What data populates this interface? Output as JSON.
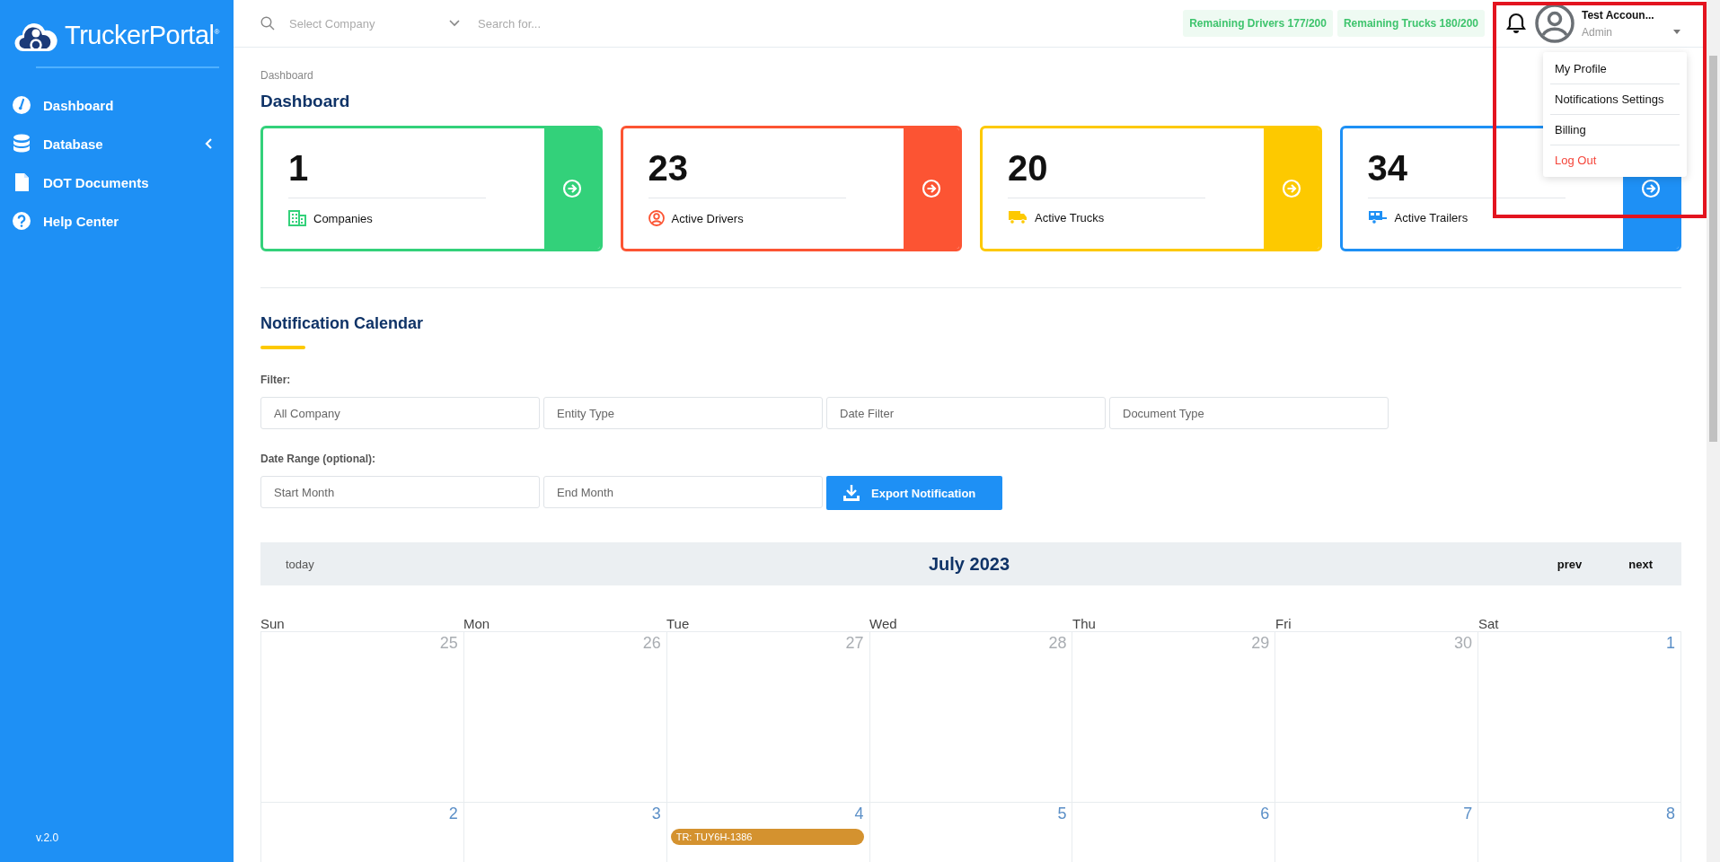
{
  "sidebar": {
    "logo": "TruckerPortal$^{®}$",
    "items": [
      {
        "label": "Dashboard",
        "kind": "gauge",
        "expandable": false
      },
      {
        "label": "Database",
        "kind": "database",
        "expandable": true
      },
      {
        "label": "DOT Documents",
        "kind": "document",
        "expandable": false
      },
      {
        "label": "Help Center",
        "kind": "help",
        "expandable": false
      }
    ],
    "version": "v.2.0"
  },
  "header": {
    "company_select": {
      "placeholder": "Select Company"
    },
    "search": {
      "placeholder": "Search for..."
    },
    "badges": [
      "Remaining Drivers 177/200",
      "Remaining Trucks 180/200"
    ],
    "user": {
      "name": "Test Accoun...",
      "role": "Admin"
    },
    "user_menu": [
      {
        "label": "My Profile",
        "kind": "normal"
      },
      {
        "label": "Notifications Settings",
        "kind": "normal"
      },
      {
        "label": "Billing",
        "kind": "normal"
      },
      {
        "label": "Log Out",
        "kind": "danger"
      }
    ]
  },
  "breadcrumb": "Dashboard",
  "page_title": "Dashboard",
  "stat_cards": [
    {
      "value": "1",
      "label": "Companies",
      "kind": "companies",
      "color": "#33d17a"
    },
    {
      "value": "23",
      "label": "Active Drivers",
      "kind": "drivers",
      "color": "#fc5433"
    },
    {
      "value": "20",
      "label": "Active Trucks",
      "kind": "trucks",
      "color": "#fdc900"
    },
    {
      "value": "34",
      "label": "Active Trailers",
      "kind": "trailers",
      "color": "#1e90f5"
    }
  ],
  "notification_calendar": {
    "title": "Notification Calendar",
    "filter_label": "Filter:",
    "filters": [
      {
        "placeholder": "All Company"
      },
      {
        "placeholder": "Entity Type"
      },
      {
        "placeholder": "Date Filter"
      },
      {
        "placeholder": "Document Type"
      }
    ],
    "date_range_label": "Date Range (optional):",
    "date_range": [
      {
        "placeholder": "Start Month"
      },
      {
        "placeholder": "End Month"
      }
    ],
    "export_button": "Export Notification",
    "toolbar": {
      "today": "today",
      "title": "July 2023",
      "prev": "prev",
      "next": "next"
    },
    "weekdays": [
      "Sun",
      "Mon",
      "Tue",
      "Wed",
      "Thu",
      "Fri",
      "Sat"
    ],
    "weeks": [
      [
        {
          "day": "25",
          "outside_month": true
        },
        {
          "day": "26",
          "outside_month": true
        },
        {
          "day": "27",
          "outside_month": true
        },
        {
          "day": "28",
          "outside_month": true
        },
        {
          "day": "29",
          "outside_month": true
        },
        {
          "day": "30",
          "outside_month": true
        },
        {
          "day": "1",
          "outside_month": false
        }
      ],
      [
        {
          "day": "2",
          "outside_month": false
        },
        {
          "day": "3",
          "outside_month": false
        },
        {
          "day": "4",
          "outside_month": false,
          "events": [
            {
              "label": "TR: TUY6H-1386",
              "color": "#d4922f"
            }
          ]
        },
        {
          "day": "5",
          "outside_month": false
        },
        {
          "day": "6",
          "outside_month": false
        },
        {
          "day": "7",
          "outside_month": false
        },
        {
          "day": "8",
          "outside_month": false
        }
      ]
    ]
  }
}
